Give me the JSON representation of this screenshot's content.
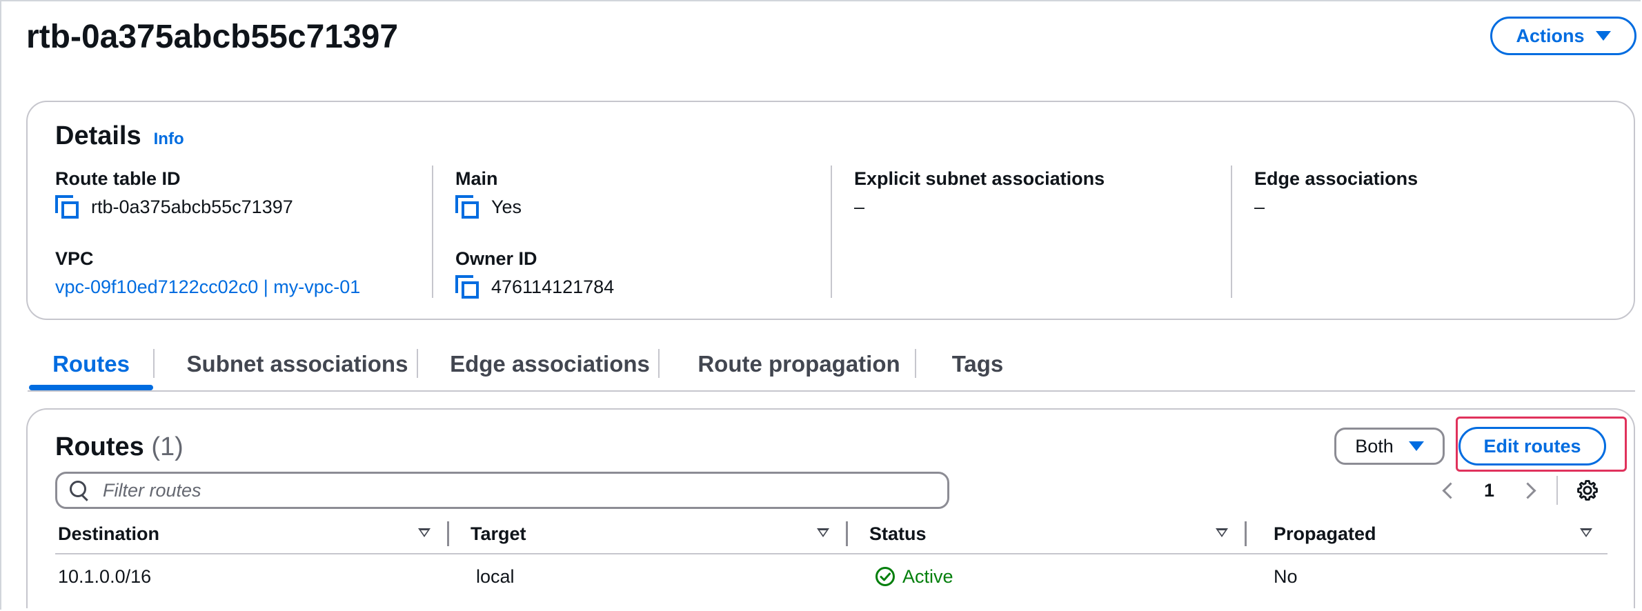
{
  "page": {
    "title": "rtb-0a375abcb55c71397",
    "actions_label": "Actions"
  },
  "details": {
    "title": "Details",
    "info_label": "Info",
    "route_table_id": {
      "label": "Route table ID",
      "value": "rtb-0a375abcb55c71397"
    },
    "vpc": {
      "label": "VPC",
      "value": "vpc-09f10ed7122cc02c0 | my-vpc-01"
    },
    "main": {
      "label": "Main",
      "value": "Yes"
    },
    "owner_id": {
      "label": "Owner ID",
      "value": "476114121784"
    },
    "explicit_subnet_associations": {
      "label": "Explicit subnet associations",
      "value": "–"
    },
    "edge_associations": {
      "label": "Edge associations",
      "value": "–"
    }
  },
  "tabs": [
    {
      "label": "Routes",
      "active": true
    },
    {
      "label": "Subnet associations",
      "active": false
    },
    {
      "label": "Edge associations",
      "active": false
    },
    {
      "label": "Route propagation",
      "active": false
    },
    {
      "label": "Tags",
      "active": false
    }
  ],
  "routes": {
    "title": "Routes",
    "count": "(1)",
    "filter_select": "Both",
    "edit_label": "Edit routes",
    "search_placeholder": "Filter routes",
    "page_number": "1",
    "columns": [
      "Destination",
      "Target",
      "Status",
      "Propagated"
    ],
    "rows": [
      {
        "destination": "10.1.0.0/16",
        "target": "local",
        "status": "Active",
        "propagated": "No"
      }
    ]
  },
  "colors": {
    "link": "#006ce0",
    "success": "#037f0c",
    "highlight": "#e0325c"
  }
}
